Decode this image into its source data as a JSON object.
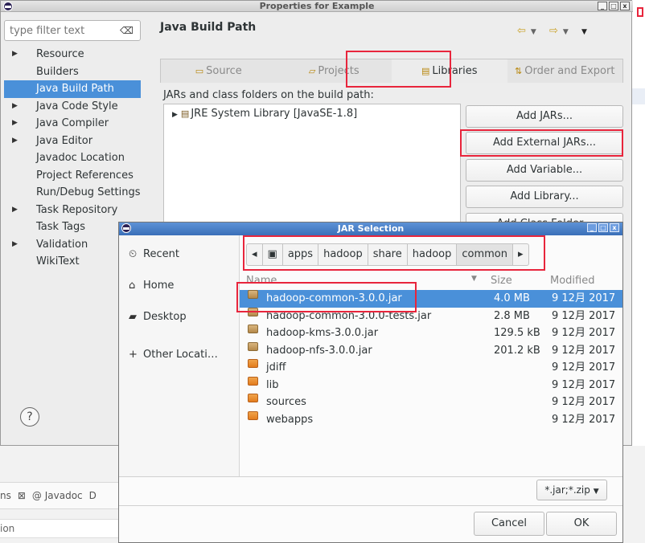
{
  "colors": {
    "selection": "#4a90d9",
    "highlight_box": "#e8253c",
    "titlebar_active": "#3a6fb8"
  },
  "properties_dialog": {
    "title": "Properties for Example",
    "filter_placeholder": "type filter text",
    "tree": [
      {
        "label": "Resource",
        "expandable": true
      },
      {
        "label": "Builders",
        "expandable": false
      },
      {
        "label": "Java Build Path",
        "expandable": false,
        "selected": true
      },
      {
        "label": "Java Code Style",
        "expandable": true
      },
      {
        "label": "Java Compiler",
        "expandable": true
      },
      {
        "label": "Java Editor",
        "expandable": true
      },
      {
        "label": "Javadoc Location",
        "expandable": false
      },
      {
        "label": "Project References",
        "expandable": false
      },
      {
        "label": "Run/Debug Settings",
        "expandable": false
      },
      {
        "label": "Task Repository",
        "expandable": true
      },
      {
        "label": "Task Tags",
        "expandable": false
      },
      {
        "label": "Validation",
        "expandable": true
      },
      {
        "label": "WikiText",
        "expandable": false
      }
    ],
    "page_title": "Java Build Path",
    "tabs": [
      "Source",
      "Projects",
      "Libraries",
      "Order and Export"
    ],
    "active_tab": "Libraries",
    "jars_label": "JARs and class folders on the build path:",
    "jar_entries": [
      "JRE System Library [JavaSE-1.8]"
    ],
    "buttons": [
      "Add JARs...",
      "Add External JARs...",
      "Add Variable...",
      "Add Library...",
      "Add Class Folder..."
    ]
  },
  "jar_selection": {
    "title": "JAR Selection",
    "places": [
      "Recent",
      "Home",
      "Desktop",
      "Other Locati…"
    ],
    "path": [
      "apps",
      "hadoop",
      "share",
      "hadoop",
      "common"
    ],
    "columns": {
      "name": "Name",
      "size": "Size",
      "modified": "Modified"
    },
    "files": [
      {
        "name": "hadoop-common-3.0.0.jar",
        "size": "4.0 MB",
        "modified": "9 12月 2017",
        "type": "jar",
        "selected": true
      },
      {
        "name": "hadoop-common-3.0.0-tests.jar",
        "size": "2.8 MB",
        "modified": "9 12月 2017",
        "type": "jar"
      },
      {
        "name": "hadoop-kms-3.0.0.jar",
        "size": "129.5 kB",
        "modified": "9 12月 2017",
        "type": "jar"
      },
      {
        "name": "hadoop-nfs-3.0.0.jar",
        "size": "201.2 kB",
        "modified": "9 12月 2017",
        "type": "jar"
      },
      {
        "name": "jdiff",
        "size": "",
        "modified": "9 12月 2017",
        "type": "dir"
      },
      {
        "name": "lib",
        "size": "",
        "modified": "9 12月 2017",
        "type": "dir"
      },
      {
        "name": "sources",
        "size": "",
        "modified": "9 12月 2017",
        "type": "dir"
      },
      {
        "name": "webapps",
        "size": "",
        "modified": "9 12月 2017",
        "type": "dir"
      }
    ],
    "filter": "*.jar;*.zip",
    "cancel": "Cancel",
    "ok": "OK"
  },
  "background": {
    "tabs": [
      "ns",
      "@ Javadoc",
      "D"
    ],
    "sub": "ion"
  }
}
